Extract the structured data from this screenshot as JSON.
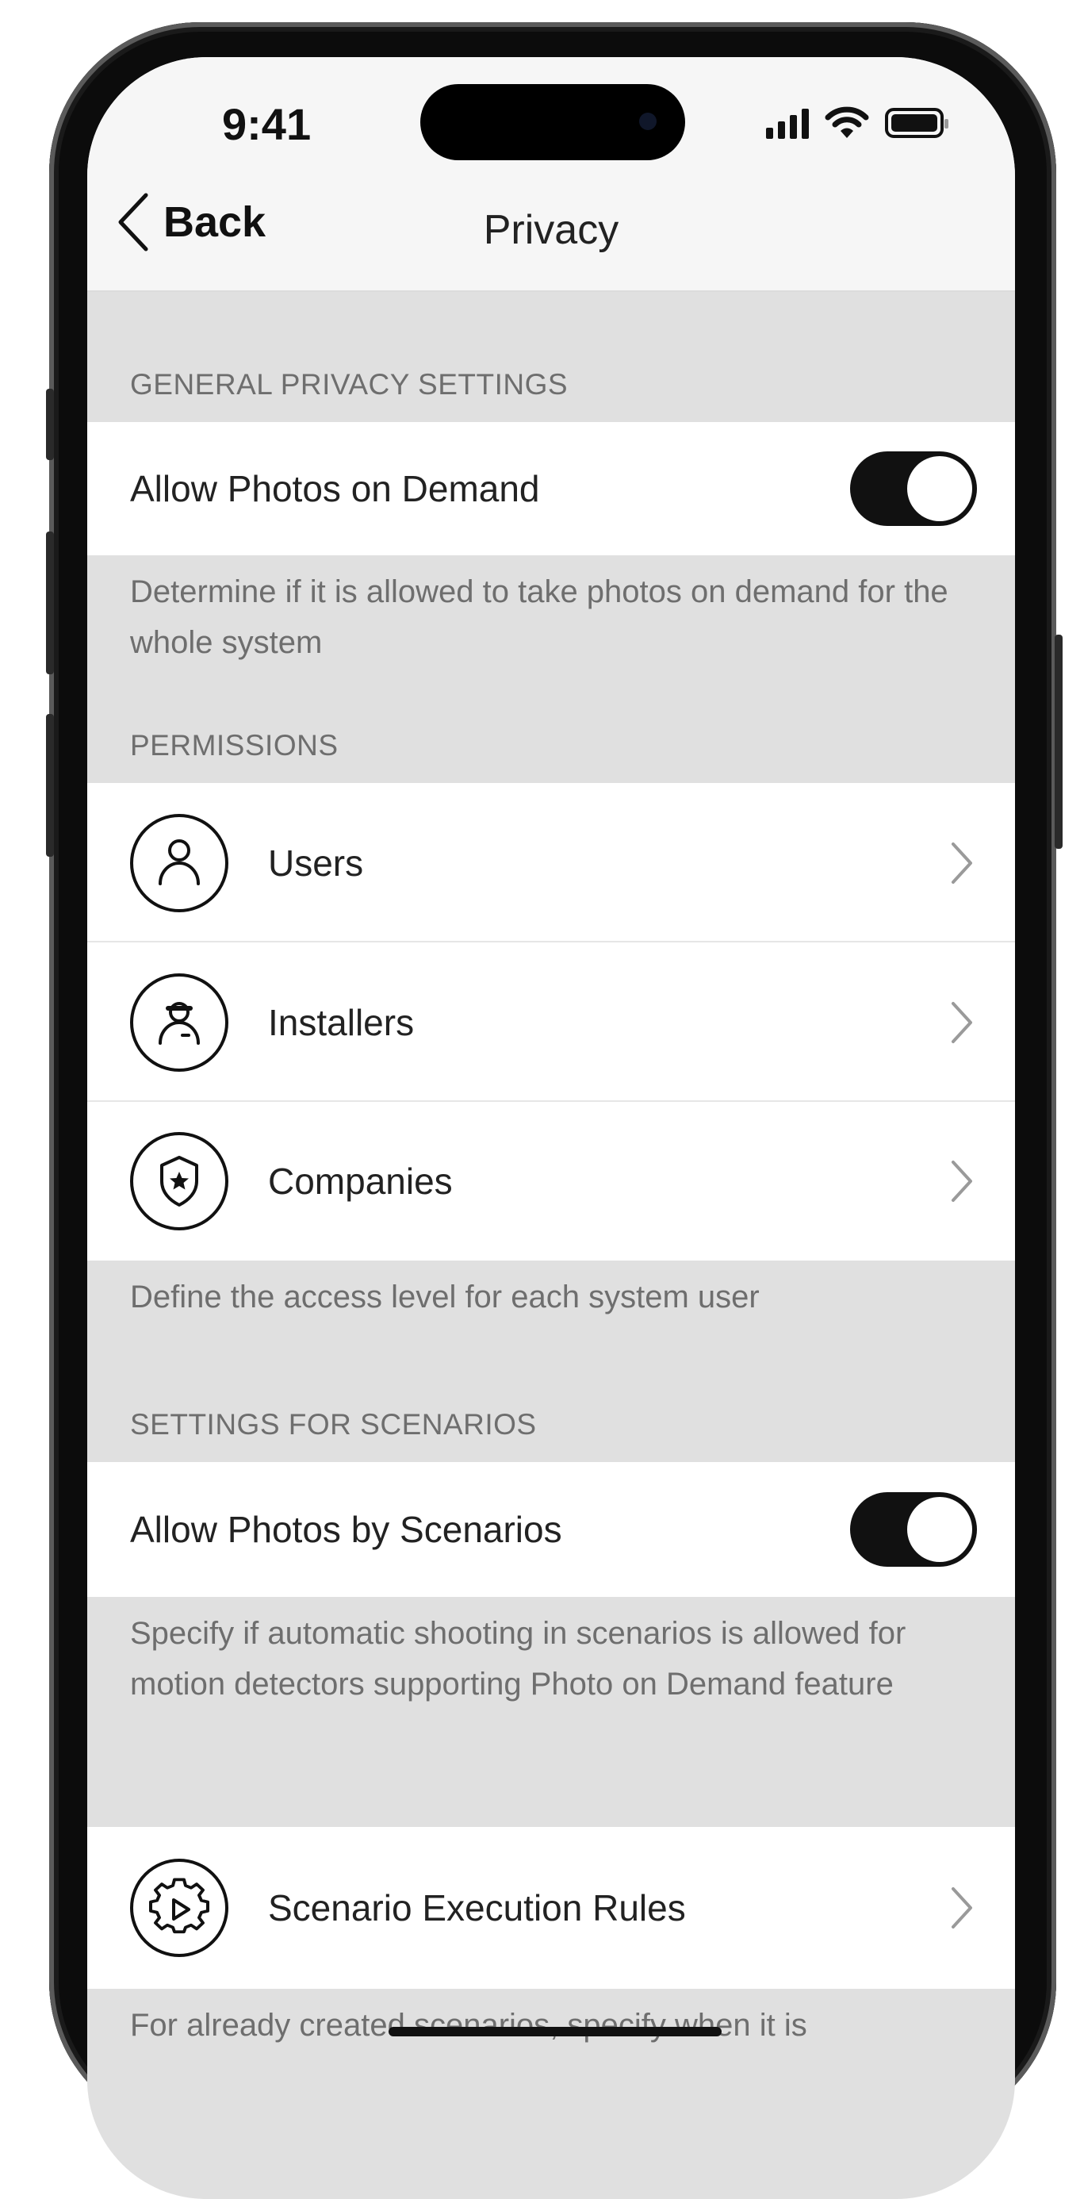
{
  "status_bar": {
    "time": "9:41"
  },
  "nav": {
    "back_label": "Back",
    "title": "Privacy"
  },
  "general": {
    "header": "GENERAL PRIVACY SETTINGS",
    "toggle_label": "Allow Photos on Demand",
    "toggle_on": true,
    "footer": "Determine if it is allowed to take photos on demand for the whole system"
  },
  "permissions": {
    "header": "PERMISSIONS",
    "items": [
      {
        "label": "Users",
        "icon": "user-icon"
      },
      {
        "label": "Installers",
        "icon": "installer-icon"
      },
      {
        "label": "Companies",
        "icon": "shield-star-icon"
      }
    ],
    "footer": "Define the access level for each system user"
  },
  "scenarios": {
    "header": "SETTINGS FOR SCENARIOS",
    "toggle_label": "Allow Photos by Scenarios",
    "toggle_on": true,
    "footer": "Specify if automatic shooting in scenarios is allowed for motion detectors supporting Photo on Demand feature"
  },
  "rules": {
    "label": "Scenario Execution Rules",
    "icon": "gear-play-icon",
    "footer": "For already created scenarios, specify when it is"
  },
  "colors": {
    "toggle_on": "#111111",
    "background": "#e0e0e0"
  }
}
